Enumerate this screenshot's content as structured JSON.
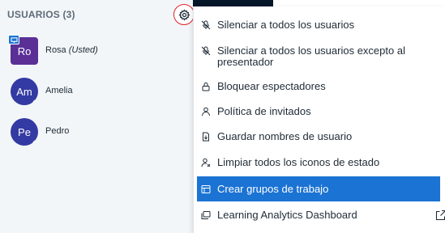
{
  "users_panel": {
    "header": "USUARIOS (3)",
    "settings_icon": "gear-icon",
    "users": [
      {
        "initials": "Ro",
        "name": "Rosa",
        "suffix": "(Usted)",
        "role": "presenter",
        "color": "#5a2f96"
      },
      {
        "initials": "Am",
        "name": "Amelia",
        "suffix": "",
        "role": "viewer",
        "color": "#333aa3"
      },
      {
        "initials": "Pe",
        "name": "Pedro",
        "suffix": "",
        "role": "viewer",
        "color": "#333aa3"
      }
    ]
  },
  "menu": {
    "items": [
      {
        "label": "Silenciar a todos los usuarios",
        "icon": "mic-off-icon"
      },
      {
        "label": "Silenciar a todos los usuarios excepto al presentador",
        "icon": "mic-off-icon"
      },
      {
        "label": "Bloquear espectadores",
        "icon": "lock-icon"
      },
      {
        "label": "Política de invitados",
        "icon": "user-icon"
      },
      {
        "label": "Guardar nombres de usuario",
        "icon": "download-file-icon"
      },
      {
        "label": "Limpiar todos los iconos de estado",
        "icon": "clear-status-icon"
      },
      {
        "label": "Crear grupos de trabajo",
        "icon": "rooms-icon",
        "active": true
      },
      {
        "label": "Learning Analytics Dashboard",
        "icon": "dashboard-icon",
        "external_icon": "external-link-icon"
      }
    ]
  },
  "colors": {
    "accent": "#1b73d3",
    "highlight_circle": "#e0232e",
    "presenter_avatar": "#5a2f96",
    "viewer_avatar": "#333aa3"
  }
}
